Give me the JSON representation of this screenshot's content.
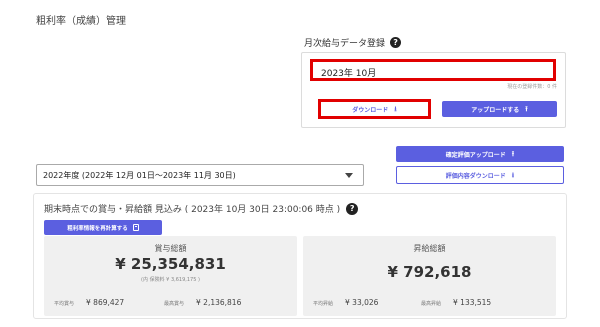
{
  "page": {
    "title": "粗利率（成績）管理"
  },
  "monthly_upload": {
    "label": "月次給与データ登録",
    "month_value": "2023年 10月",
    "registered_count": "現在の登録件数：0 件",
    "download_label": "ダウンロード",
    "upload_label": "アップロードする"
  },
  "actions": {
    "confirm_upload_label": "確定評価アップロード",
    "eval_download_label": "評価内容ダウンロード"
  },
  "fiscal_year": {
    "selected": "2022年度 (2022年 12月 01日〜2023年 11月 30日)"
  },
  "forecast": {
    "title": "期末時点での賞与・昇給額 見込み ( 2023年 10月 30日 23:00:06 時点 )",
    "recalc_label": "粗利率情報を再計算する",
    "bonus": {
      "title": "賞与総額",
      "amount": "¥ 25,354,831",
      "sub": "(内 保険料 ¥ 3,619,175 )",
      "avg_label": "平均賞与",
      "avg_value": "¥ 869,427",
      "max_label": "最高賞与",
      "max_value": "¥ 2,136,816"
    },
    "raise": {
      "title": "昇給総額",
      "amount": "¥ 792,618",
      "avg_label": "平均昇給",
      "avg_value": "¥ 33,026",
      "max_label": "最高昇給",
      "max_value": "¥ 133,515"
    }
  },
  "icons": {
    "help": "question-circle-icon",
    "download": "download-icon",
    "upload": "upload-icon",
    "calculator": "calculator-icon"
  },
  "colors": {
    "accent": "#5b5fe0",
    "highlight": "#e10000"
  }
}
